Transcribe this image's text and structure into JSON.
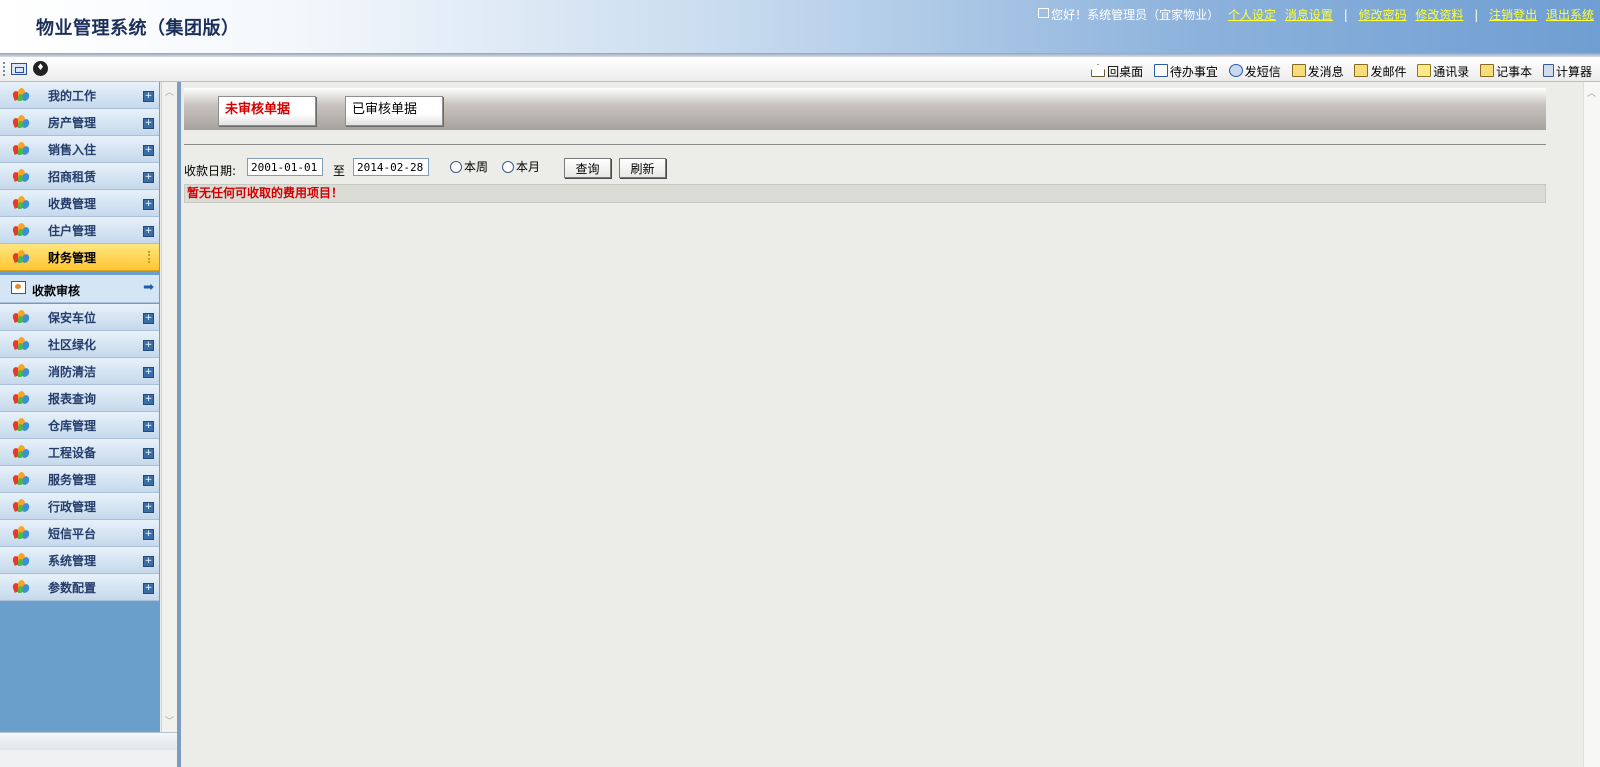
{
  "header": {
    "title": "物业管理系统（集团版）",
    "greeting": "您好！系统管理员（宜家物业）",
    "links": [
      "个人设定",
      "消息设置",
      "修改密码",
      "修改资料",
      "注销登出",
      "退出系统"
    ],
    "separator": "|"
  },
  "toolbar": {
    "items": [
      {
        "label": "回桌面",
        "icon": "home-icon"
      },
      {
        "label": "待办事宜",
        "icon": "todo-icon"
      },
      {
        "label": "发短信",
        "icon": "sms-icon"
      },
      {
        "label": "发消息",
        "icon": "message-icon"
      },
      {
        "label": "发邮件",
        "icon": "mail-icon"
      },
      {
        "label": "通讯录",
        "icon": "address-book-icon"
      },
      {
        "label": "记事本",
        "icon": "notepad-icon"
      },
      {
        "label": "计算器",
        "icon": "calculator-icon"
      }
    ]
  },
  "sidebar": {
    "items": [
      {
        "label": "我的工作"
      },
      {
        "label": "房产管理"
      },
      {
        "label": "销售入住"
      },
      {
        "label": "招商租赁"
      },
      {
        "label": "收费管理"
      },
      {
        "label": "住户管理"
      },
      {
        "label": "财务管理",
        "active": true
      },
      {
        "label": "保安车位"
      },
      {
        "label": "社区绿化"
      },
      {
        "label": "消防清洁"
      },
      {
        "label": "报表查询"
      },
      {
        "label": "仓库管理"
      },
      {
        "label": "工程设备"
      },
      {
        "label": "服务管理"
      },
      {
        "label": "行政管理"
      },
      {
        "label": "短信平台"
      },
      {
        "label": "系统管理"
      },
      {
        "label": "参数配置"
      }
    ],
    "sub_item": {
      "label": "收款审核"
    }
  },
  "main": {
    "tabs": {
      "unreviewed": "未审核单据",
      "reviewed": "已审核单据"
    },
    "filter": {
      "date_label": "收款日期:",
      "from": "2001-01-01",
      "to_label": "至",
      "to": "2014-02-28",
      "week_label": "本周",
      "month_label": "本月",
      "query_label": "查询",
      "refresh_label": "刷新"
    },
    "empty_message": "暂无任何可收取的费用项目！"
  },
  "colors": {
    "header_title": "#1c2f5a",
    "link_yellow": "#ffff33",
    "alert_red": "#d40000",
    "active_nav": "#ffc633",
    "sidebar_bg": "#6a9fcc"
  }
}
